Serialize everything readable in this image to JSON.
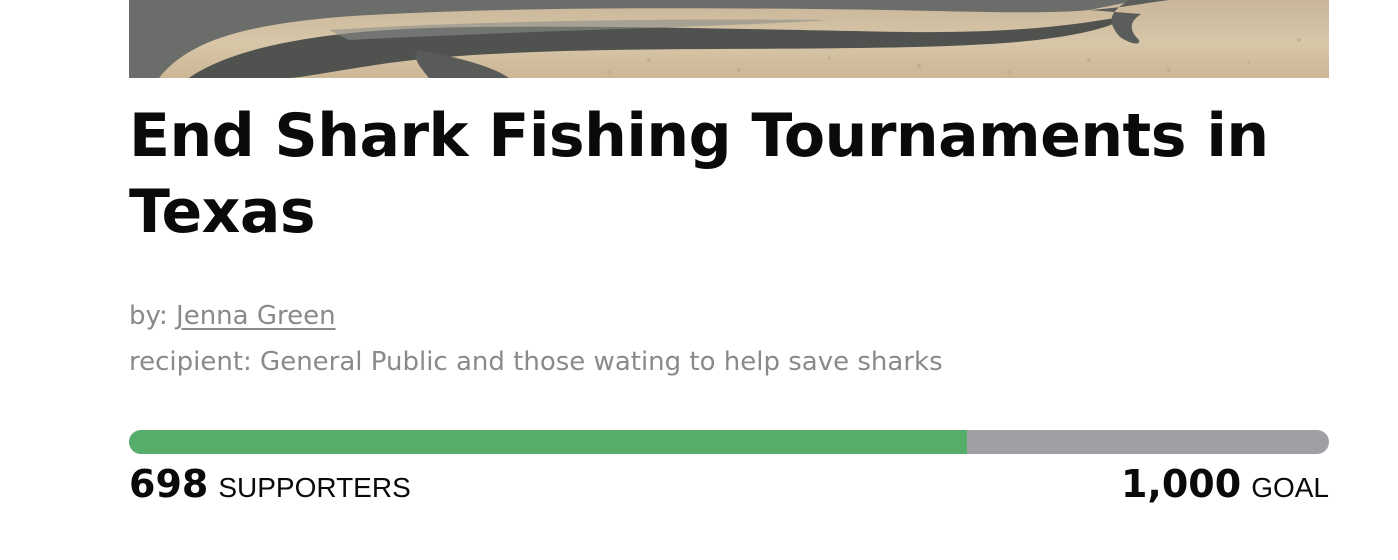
{
  "hero_image": {
    "alt": "shark lying on sand",
    "icon": "shark-photo"
  },
  "petition": {
    "title": "End Shark Fishing Tournaments in Texas",
    "by_label": "by:",
    "author": "Jenna Green",
    "recipient": "recipient: General Public and those wating to help save sharks"
  },
  "progress": {
    "supporters": "698",
    "supporters_label": "SUPPORTERS",
    "goal": "1,000",
    "goal_label": "GOAL",
    "fraction": 0.698,
    "fill_color": "#55ad69",
    "track_color": "#9ea0a6"
  }
}
